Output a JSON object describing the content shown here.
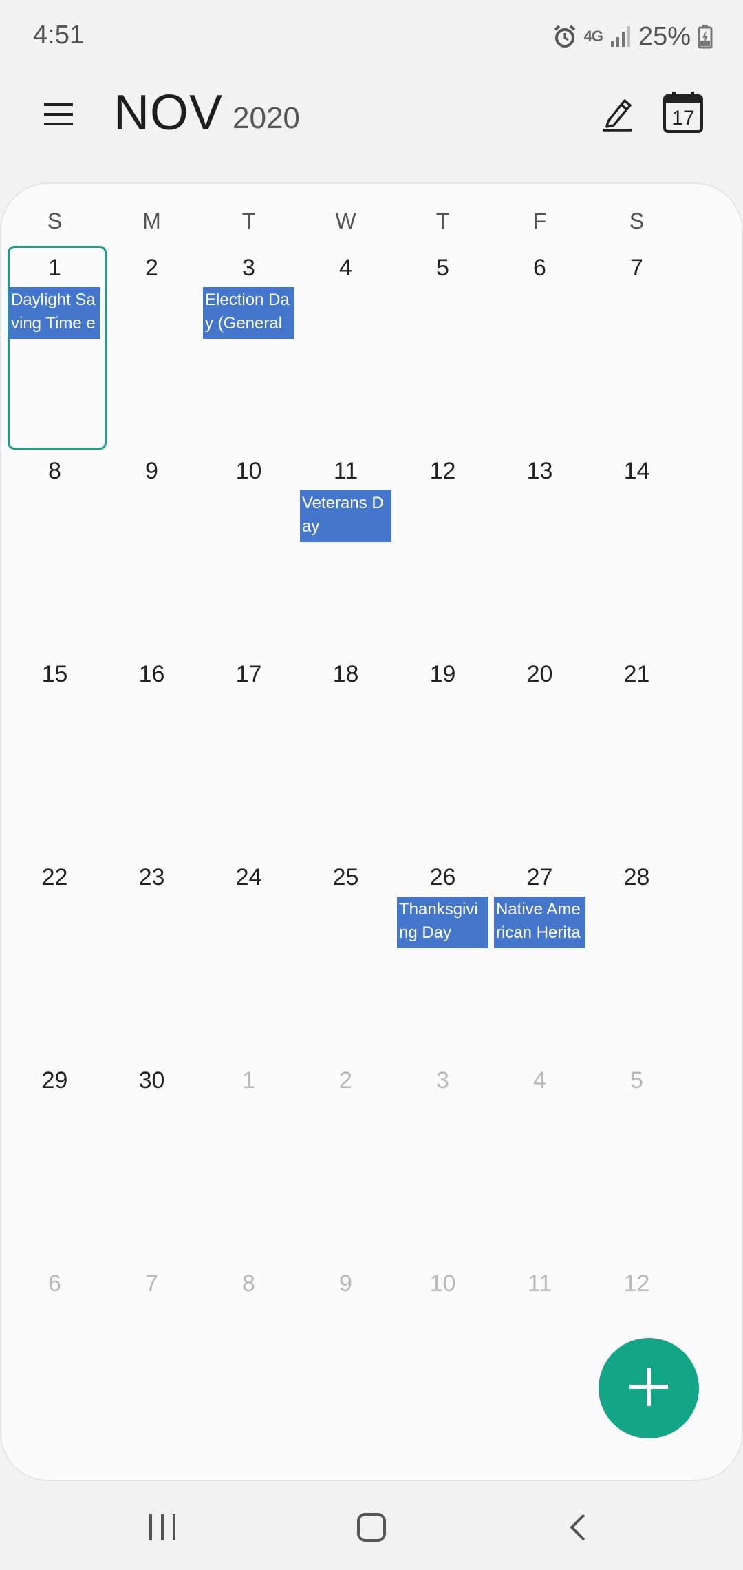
{
  "status_bar": {
    "time": "4:51",
    "network": "4G",
    "battery": "25%"
  },
  "header": {
    "month": "NOV",
    "year": "2020",
    "today_badge": "17"
  },
  "weekdays": [
    "S",
    "M",
    "T",
    "W",
    "T",
    "F",
    "S"
  ],
  "weeks": [
    [
      {
        "day": "1",
        "current": true,
        "selected": true,
        "event": "Daylight Saving Time e"
      },
      {
        "day": "2",
        "current": true
      },
      {
        "day": "3",
        "current": true,
        "event": "Election Day (General E"
      },
      {
        "day": "4",
        "current": true
      },
      {
        "day": "5",
        "current": true
      },
      {
        "day": "6",
        "current": true
      },
      {
        "day": "7",
        "current": true
      }
    ],
    [
      {
        "day": "8",
        "current": true
      },
      {
        "day": "9",
        "current": true
      },
      {
        "day": "10",
        "current": true
      },
      {
        "day": "11",
        "current": true,
        "event": "Veterans Day"
      },
      {
        "day": "12",
        "current": true
      },
      {
        "day": "13",
        "current": true
      },
      {
        "day": "14",
        "current": true
      }
    ],
    [
      {
        "day": "15",
        "current": true
      },
      {
        "day": "16",
        "current": true
      },
      {
        "day": "17",
        "current": true
      },
      {
        "day": "18",
        "current": true
      },
      {
        "day": "19",
        "current": true
      },
      {
        "day": "20",
        "current": true
      },
      {
        "day": "21",
        "current": true
      }
    ],
    [
      {
        "day": "22",
        "current": true
      },
      {
        "day": "23",
        "current": true
      },
      {
        "day": "24",
        "current": true
      },
      {
        "day": "25",
        "current": true
      },
      {
        "day": "26",
        "current": true,
        "event": "Thanksgiving Day"
      },
      {
        "day": "27",
        "current": true,
        "event": "Native American Heritag"
      },
      {
        "day": "28",
        "current": true
      }
    ],
    [
      {
        "day": "29",
        "current": true
      },
      {
        "day": "30",
        "current": true
      },
      {
        "day": "1",
        "current": false
      },
      {
        "day": "2",
        "current": false
      },
      {
        "day": "3",
        "current": false
      },
      {
        "day": "4",
        "current": false
      },
      {
        "day": "5",
        "current": false
      }
    ],
    [
      {
        "day": "6",
        "current": false
      },
      {
        "day": "7",
        "current": false
      },
      {
        "day": "8",
        "current": false
      },
      {
        "day": "9",
        "current": false
      },
      {
        "day": "10",
        "current": false
      },
      {
        "day": "11",
        "current": false
      },
      {
        "day": "12",
        "current": false
      }
    ]
  ],
  "colors": {
    "accent": "#12a586",
    "event": "#4477cc",
    "selected_border": "#1a9e86"
  },
  "icons": {
    "menu": "hamburger-menu-icon",
    "edit": "pencil-icon",
    "today": "calendar-today-icon",
    "fab": "plus-icon"
  }
}
